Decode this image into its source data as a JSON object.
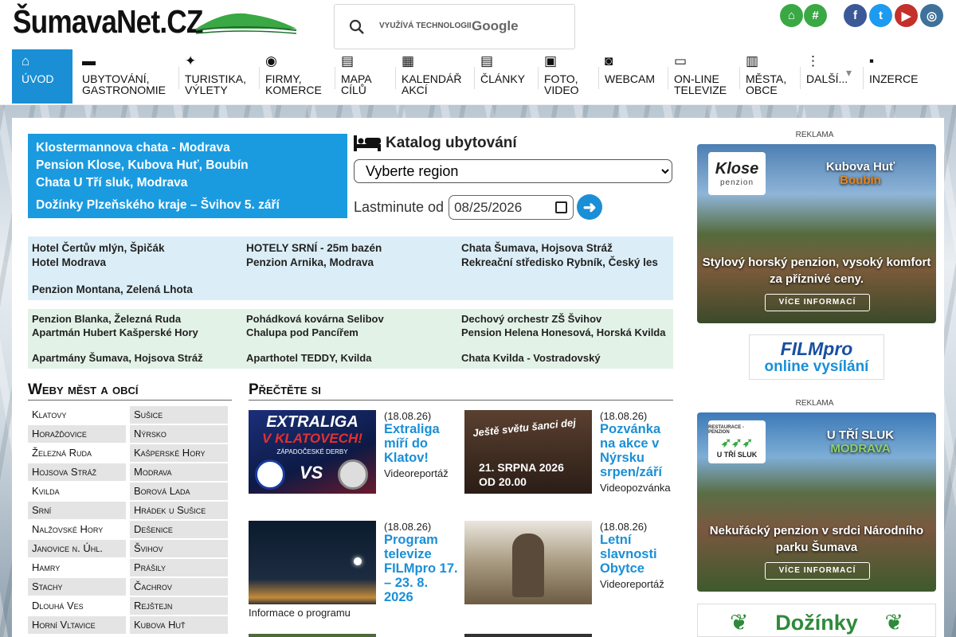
{
  "header": {
    "logo": "ŠumavaNet.CZ",
    "search_powered": "VYUŽÍVÁ TECHNOLOGII",
    "search_brand": "Google",
    "top_icons": [
      {
        "name": "home-icon",
        "color": "#3aa844",
        "glyph": "⌂"
      },
      {
        "name": "hash-icon",
        "color": "#3aa844",
        "glyph": "#"
      },
      {
        "name": "facebook-icon",
        "color": "#3b5998",
        "glyph": "f"
      },
      {
        "name": "twitter-icon",
        "color": "#1d9bf0",
        "glyph": "t"
      },
      {
        "name": "youtube-icon",
        "color": "#c4302b",
        "glyph": "▶"
      },
      {
        "name": "instagram-icon",
        "color": "#3f729b",
        "glyph": "◎"
      }
    ]
  },
  "nav": [
    {
      "l1": "Úvod",
      "l2": "",
      "icon": "home-icon"
    },
    {
      "l1": "Ubytování,",
      "l2": "gastronomie",
      "icon": "bed-icon"
    },
    {
      "l1": "Turistika,",
      "l2": "výlety",
      "icon": "hiker-icon"
    },
    {
      "l1": "Firmy,",
      "l2": "komerce",
      "icon": "coins-icon"
    },
    {
      "l1": "Mapa",
      "l2": "cílů",
      "icon": "map-icon"
    },
    {
      "l1": "Kalendář",
      "l2": "akcí",
      "icon": "calendar-icon"
    },
    {
      "l1": "Články",
      "l2": "",
      "icon": "newspaper-icon"
    },
    {
      "l1": "Foto,",
      "l2": "video",
      "icon": "images-icon"
    },
    {
      "l1": "Webcam",
      "l2": "",
      "icon": "camera-icon"
    },
    {
      "l1": "On-line",
      "l2": "televize",
      "icon": "tv-icon"
    },
    {
      "l1": "Města,",
      "l2": "obce",
      "icon": "building-icon"
    },
    {
      "l1": "Další...",
      "l2": "",
      "icon": "dots-icon"
    },
    {
      "l1": "Inzerce",
      "l2": "",
      "icon": "ad-icon"
    }
  ],
  "featured": [
    "Klostermannova chata - Modrava",
    "Pension Klose, Kubova Huť, Boubín",
    "Chata U Tří sluk, Modrava",
    "Dožínky Plzeňského kraje – Švihov 5. září"
  ],
  "catalog": {
    "title": "Katalog ubytování",
    "select_value": "Vyberte region",
    "lastminute_label": "Lastminute od",
    "date_value": "08/25/2026"
  },
  "hotels1": [
    "Hotel Čertův mlýn, Špičák",
    "HOTELY SRNÍ - 25m bazén",
    "Chata Šumava, Hojsova Stráž",
    "Hotel Modrava",
    "Penzion Arnika, Modrava",
    "Rekreační středisko Rybník, Český les",
    "Penzion Montana, Zelená Lhota"
  ],
  "hotels2": [
    "Penzion Blanka, Železná Ruda",
    "Pohádková kovárna Selibov",
    "Dechový orchestr ZŠ Švihov",
    "Apartmán Hubert Kašperské Hory",
    "Chalupa pod Pancířem",
    "Pension Helena Honesová, Horská Kvilda",
    "Apartmány Šumava, Hojsova Stráž",
    "Aparthotel TEDDY, Kvilda",
    "Chata Kvilda - Vostradovský"
  ],
  "cities_title": "Weby měst a obcí",
  "cities": [
    "Klatovy",
    "Sušice",
    "Horažďovice",
    "Nýrsko",
    "Železná Ruda",
    "Kašperské Hory",
    "Hojsova Stráž",
    "Modrava",
    "Kvilda",
    "Borová Lada",
    "Srní",
    "Hrádek u Sušice",
    "Nalžovské Hory",
    "Dešenice",
    "Janovice n. Úhl.",
    "Švihov",
    "Hamry",
    "Prášily",
    "Stachy",
    "Čachrov",
    "Dlouhá Ves",
    "Rejštejn",
    "Horní Vltavice",
    "Kubova Huť"
  ],
  "articles_title": "Přečtěte si",
  "articles": [
    {
      "date": "(18.08.26)",
      "title": "Extraliga míří do Klatov!",
      "type": "Videoreportáž",
      "thumb_top": "EXTRALIGA",
      "thumb_mid": "V KLATOVECH!",
      "thumb_sub": "ZÁPADOČESKÉ DERBY"
    },
    {
      "date": "(18.08.26)",
      "title": "Pozvánka na akce v Nýrsku srpen/září",
      "type": "Videopozvánka",
      "thumb_top": "Ještě světu šanci dej",
      "thumb_mid": "21. SRPNA 2026",
      "thumb_sub": "OD 20.00"
    },
    {
      "date": "(18.08.26)",
      "title": "Program televize FILMpro 17. – 23. 8. 2026",
      "type": "Informace o programu"
    },
    {
      "date": "(18.08.26)",
      "title": "Letní slavnosti Obytce",
      "type": "Videoreportáž"
    }
  ],
  "ads": [
    {
      "label": "REKLAMA",
      "logo": "Klose",
      "logo_sub": "penzion",
      "town": "Kubova Huť",
      "town_sub": "Boubín",
      "slogan": "Stylový horský penzion, vysoký komfort za příznivé ceny.",
      "button": "VÍCE INFORMACÍ"
    },
    {
      "label": "REKLAMA",
      "logo": "U TŘÍ SLUK",
      "logo_sub": "RESTAURACE - PENZION",
      "town": "U TŘÍ SLUK",
      "town_sub": "MODRAVA",
      "slogan": "Nekuřácký penzion v srdci Národního parku Šumava",
      "button": "VÍCE INFORMACÍ"
    }
  ],
  "filmpro": {
    "top": "FILMpro",
    "bottom": "online vysílání"
  },
  "dozinky": "Dožínky"
}
